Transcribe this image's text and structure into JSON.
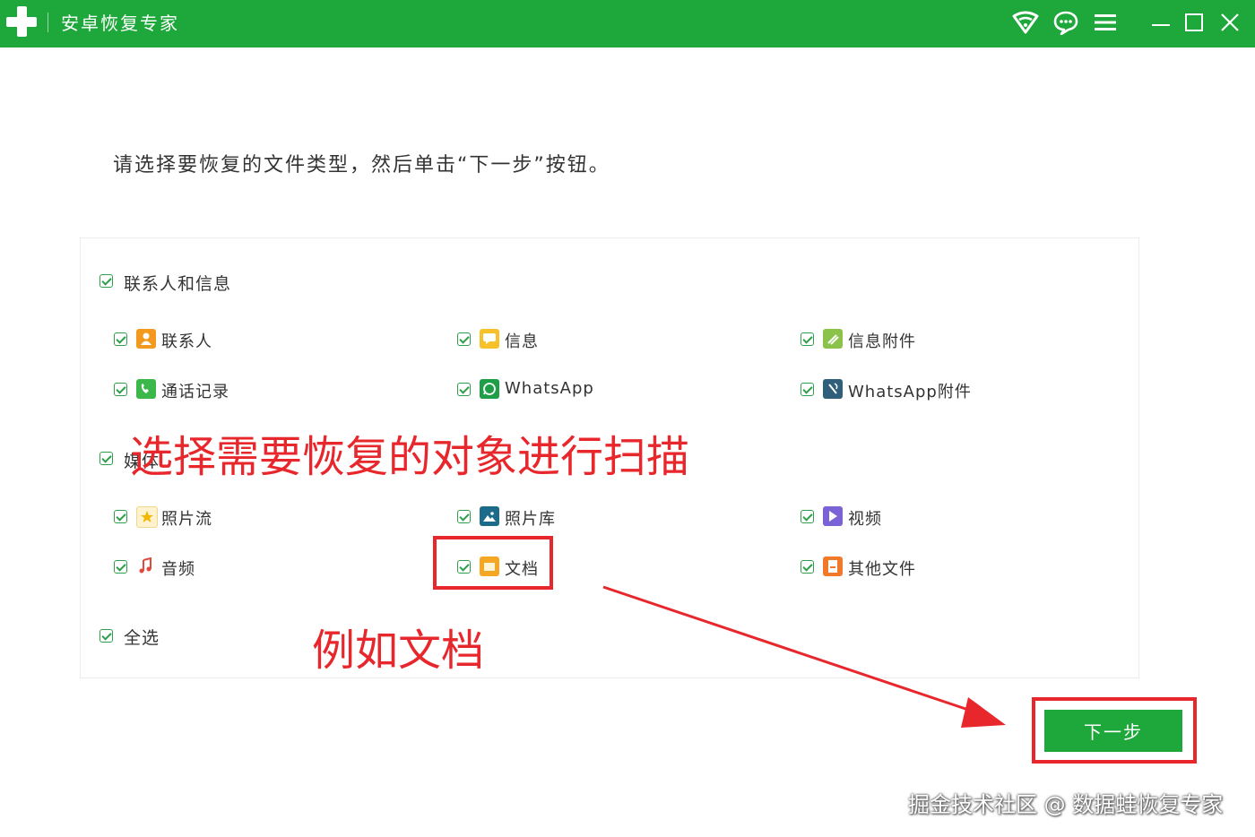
{
  "app": {
    "title": "安卓恢复专家"
  },
  "titlebar_icons": [
    "wifi-icon",
    "chat-icon",
    "menu-icon",
    "minimize-icon",
    "maximize-icon",
    "close-icon"
  ],
  "instruction": "请选择要恢复的文件类型，然后单击“下一步”按钮。",
  "groups": {
    "contacts_messages": {
      "label": "联系人和信息",
      "items": [
        {
          "label": "联系人",
          "icon": "contact-icon",
          "color": "#f39a1e",
          "checked": true
        },
        {
          "label": "信息",
          "icon": "message-icon",
          "color": "#f6c12a",
          "checked": true
        },
        {
          "label": "信息附件",
          "icon": "attachment-icon",
          "color": "#8bc34a",
          "checked": true
        },
        {
          "label": "通话记录",
          "icon": "phone-icon",
          "color": "#3cb84b",
          "checked": true
        },
        {
          "label": "WhatsApp",
          "icon": "whatsapp-icon",
          "color": "#1f9e48",
          "checked": true
        },
        {
          "label": "WhatsApp附件",
          "icon": "whatsapp-attachment-icon",
          "color": "#2f5f7a",
          "checked": true
        }
      ]
    },
    "media": {
      "label": "媒体",
      "items": [
        {
          "label": "照片流",
          "icon": "photostream-icon",
          "color": "#f2c335",
          "checked": true
        },
        {
          "label": "照片库",
          "icon": "gallery-icon",
          "color": "#1d6b8a",
          "checked": true
        },
        {
          "label": "视频",
          "icon": "video-icon",
          "color": "#7b63d6",
          "checked": true
        },
        {
          "label": "音频",
          "icon": "audio-icon",
          "color": "#e4483c",
          "checked": true
        },
        {
          "label": "文档",
          "icon": "document-icon",
          "color": "#f5a623",
          "checked": true
        },
        {
          "label": "其他文件",
          "icon": "other-file-icon",
          "color": "#f07a2a",
          "checked": true
        }
      ]
    },
    "select_all": {
      "label": "全选",
      "checked": true
    }
  },
  "buttons": {
    "next": "下一步"
  },
  "annotations": {
    "main": "选择需要恢复的对象进行扫描",
    "example": "例如文档"
  },
  "watermark": "掘金技术社区 @ 数据蛙恢复专家",
  "colors": {
    "brand_green": "#1ea73a",
    "annotation_red": "#e8272c"
  }
}
